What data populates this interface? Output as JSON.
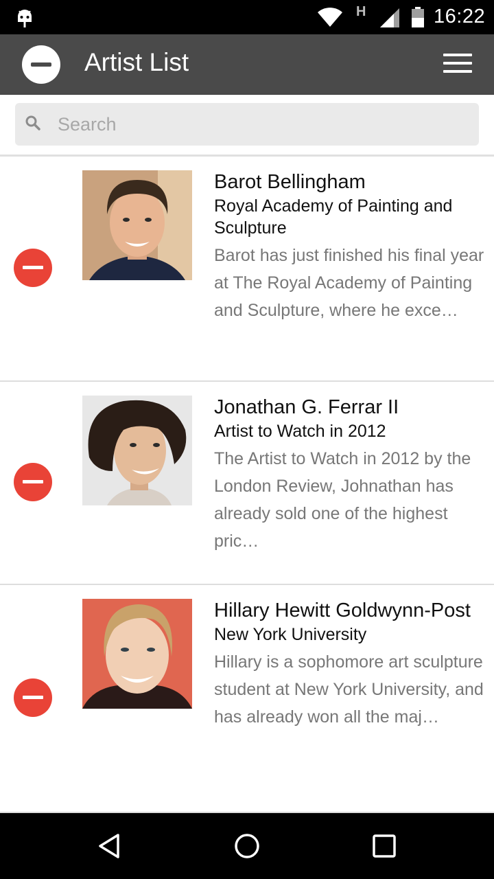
{
  "status_bar": {
    "network_type": "H",
    "time": "16:22"
  },
  "app_bar": {
    "title": "Artist List",
    "left_icon": "minus-circle-icon",
    "right_icon": "menu-icon"
  },
  "search": {
    "placeholder": "Search",
    "value": ""
  },
  "artists": [
    {
      "name": "Barot Bellingham",
      "school": "Royal Academy of Painting and Sculpture",
      "description": "Barot has just finished his final year at The Royal Academy of Painting and Sculpture, where he exce…",
      "photo_colors": {
        "bg": "#c9a27e",
        "skin": "#e8b592",
        "hair": "#3a2a1d",
        "shirt": "#1e2740"
      }
    },
    {
      "name": "Jonathan G. Ferrar II",
      "school": "Artist to Watch in 2012",
      "description": "The Artist to Watch in 2012 by the London Review, Johnathan has already sold one of the highest pric…",
      "photo_colors": {
        "bg": "#e7e7e7",
        "skin": "#e4bb99",
        "hair": "#2a1d16",
        "shirt": "#d8cfc6"
      }
    },
    {
      "name": "Hillary Hewitt Goldwynn-Post",
      "school": "New York University",
      "description": "Hillary is a sophomore art sculpture student at New York University, and has already won all the maj…",
      "photo_colors": {
        "bg": "#e06650",
        "skin": "#f1cfb4",
        "hair": "#c9a26a",
        "shirt": "#2a1a18"
      }
    }
  ],
  "nav_bar": {
    "back_icon": "back-triangle-icon",
    "home_icon": "home-circle-icon",
    "recents_icon": "recents-square-icon"
  }
}
